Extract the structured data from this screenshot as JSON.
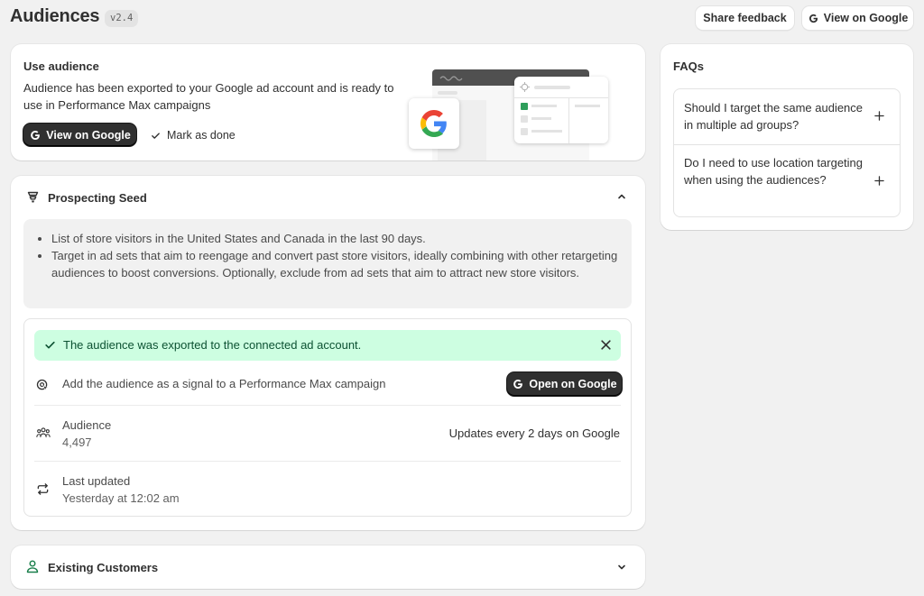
{
  "header": {
    "title": "Audiences",
    "version": "v2.4",
    "share_feedback": "Share feedback",
    "view_on_google": "View on Google"
  },
  "use_audience": {
    "title": "Use audience",
    "description": "Audience has been exported to your Google ad account and is ready to use in Performance Max campaigns",
    "view_button": "View on Google",
    "mark_done": "Mark as done"
  },
  "prospecting": {
    "title": "Prospecting Seed",
    "bullets": [
      "List of store visitors in the United States and Canada in the last 90 days.",
      "Target in ad sets that aim to reengage and convert past store visitors, ideally combining with other retargeting audiences to boost conversions. Optionally, exclude from ad sets that aim to attract new store visitors."
    ],
    "banner": "The audience was exported to the connected ad account.",
    "signal_text": "Add the audience as a signal to a Performance Max campaign",
    "open_button": "Open on Google",
    "audience_label": "Audience",
    "audience_value": "4,497",
    "updates_text": "Updates every 2 days on Google",
    "last_updated_label": "Last updated",
    "last_updated_value": "Yesterday at 12:02 am"
  },
  "existing": {
    "title": "Existing Customers"
  },
  "faqs": {
    "title": "FAQs",
    "items": [
      {
        "question": "Should I target the same audience in multiple ad groups?"
      },
      {
        "question": "Do I need to use location targeting when using the audiences?"
      }
    ]
  },
  "colors": {
    "background": "#f1f1f1",
    "dark_button": "#303030",
    "success_bg": "#cdfee1",
    "success_text": "#0c5132",
    "google_blue": "#4285F4",
    "google_red": "#EA4335",
    "google_yellow": "#FBBC05",
    "google_green": "#34A853"
  },
  "icons": [
    "google-icon",
    "check-icon",
    "funnel-icon",
    "chevron-up-icon",
    "chevron-down-icon",
    "close-icon",
    "target-icon",
    "people-icon",
    "refresh-icon",
    "person-icon",
    "plus-icon"
  ]
}
